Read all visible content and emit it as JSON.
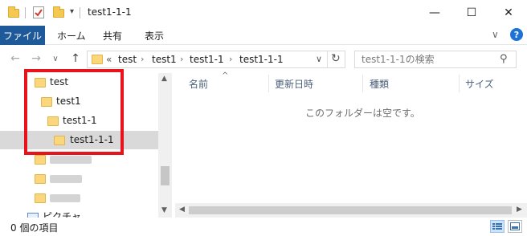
{
  "window": {
    "title": "test1-1-1",
    "minimize_icon": "—",
    "maximize_icon": "☐",
    "close_icon": "✕"
  },
  "ribbon": {
    "tabs": [
      "ファイル",
      "ホーム",
      "共有",
      "表示"
    ],
    "expand_icon": "∨",
    "help_icon": "?"
  },
  "address": {
    "back_icon": "←",
    "forward_icon": "→",
    "recent_icon": "∨",
    "up_icon": "↑",
    "overflow": "«",
    "crumbs": [
      "test",
      "test1",
      "test1-1",
      "test1-1-1"
    ],
    "separator": "›",
    "dropdown_icon": "∨",
    "refresh_icon": "↻"
  },
  "search": {
    "placeholder": "test1-1-1の検索",
    "icon": "⚲"
  },
  "nav_pane": {
    "items": [
      {
        "label": "test"
      },
      {
        "label": "test1"
      },
      {
        "label": "test1-1"
      },
      {
        "label": "test1-1-1"
      }
    ],
    "partial_item": "ピクチャ"
  },
  "content": {
    "columns": [
      "名前",
      "更新日時",
      "種類",
      "サイズ"
    ],
    "sort_indicator": "^",
    "empty_message": "このフォルダーは空です。"
  },
  "status": {
    "text": "0 個の項目"
  },
  "colors": {
    "file_tab": "#1e5a99",
    "highlight_border": "#e8141c",
    "folder": "#fbd67a",
    "selected_row": "#d9d9d9"
  }
}
